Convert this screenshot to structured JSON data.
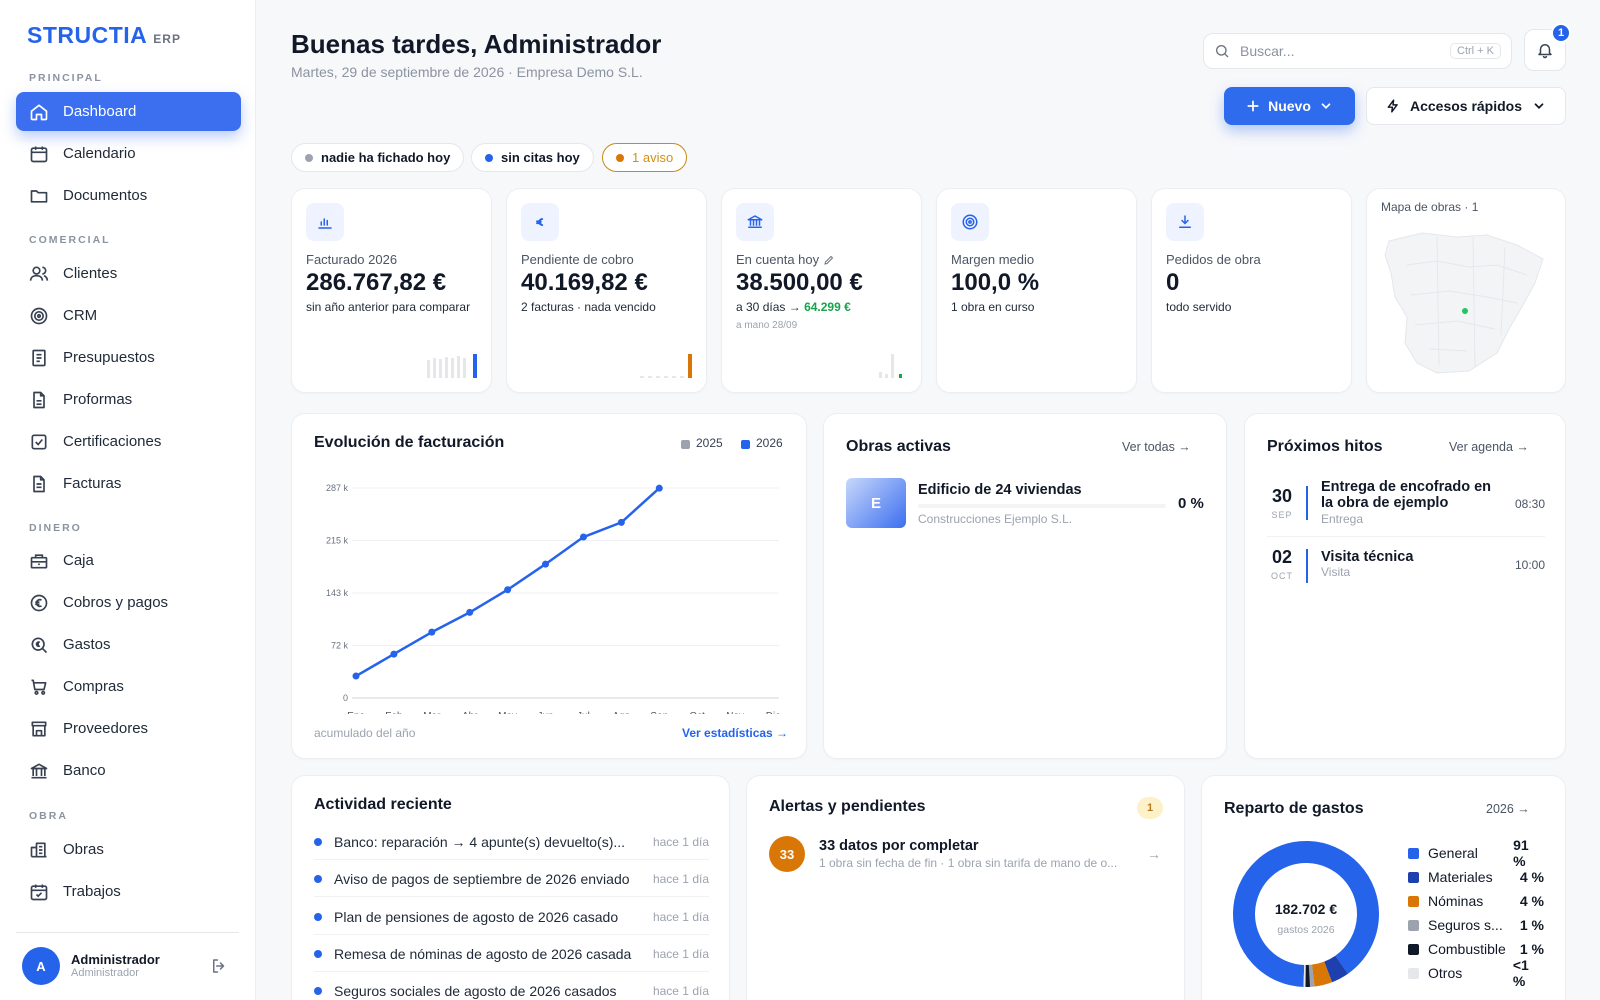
{
  "brand": {
    "name": "STRUCTIA",
    "suffix": "ERP"
  },
  "nav": {
    "sections": [
      "PRINCIPAL",
      "COMERCIAL",
      "DINERO",
      "OBRA"
    ],
    "items": [
      {
        "label": "Dashboard",
        "icon": "home-icon"
      },
      {
        "label": "Calendario",
        "icon": "calendar-icon"
      },
      {
        "label": "Documentos",
        "icon": "folder-icon"
      },
      {
        "label": "Clientes",
        "icon": "users-icon"
      },
      {
        "label": "CRM",
        "icon": "target-icon"
      },
      {
        "label": "Presupuestos",
        "icon": "document-list-icon"
      },
      {
        "label": "Proformas",
        "icon": "document-icon"
      },
      {
        "label": "Certificaciones",
        "icon": "checkbox-icon"
      },
      {
        "label": "Facturas",
        "icon": "invoice-icon"
      },
      {
        "label": "Caja",
        "icon": "cash-register-icon"
      },
      {
        "label": "Cobros y pagos",
        "icon": "euro-circle-icon"
      },
      {
        "label": "Gastos",
        "icon": "search-euro-icon"
      },
      {
        "label": "Compras",
        "icon": "cart-icon"
      },
      {
        "label": "Proveedores",
        "icon": "store-icon"
      },
      {
        "label": "Banco",
        "icon": "bank-icon"
      },
      {
        "label": "Obras",
        "icon": "buildings-icon"
      },
      {
        "label": "Trabajos",
        "icon": "calendar-check-icon"
      }
    ]
  },
  "user": {
    "initial": "A",
    "name": "Administrador",
    "role": "Administrador"
  },
  "header": {
    "greeting": "Buenas tardes, Administrador",
    "subtitle": "Martes, 29 de septiembre de 2026 · Empresa Demo S.L.",
    "search_placeholder": "Buscar...",
    "search_shortcut": "Ctrl + K",
    "notifications": "1",
    "new_button": "Nuevo",
    "quick_button": "Accesos rápidos"
  },
  "pills": [
    {
      "label": "nadie ha fichado hoy",
      "color": "#9ca3af"
    },
    {
      "label": "sin citas hoy",
      "color": "#2563eb"
    },
    {
      "label": "1 aviso",
      "color": "#d97706"
    }
  ],
  "kpis": [
    {
      "label": "Facturado 2026",
      "value": "286.767,82 €",
      "sub": "sin año anterior para comparar"
    },
    {
      "label": "Pendiente de cobro",
      "value": "40.169,82 €",
      "sub": "2 facturas · nada vencido"
    },
    {
      "label": "En cuenta hoy",
      "value": "38.500,00 €",
      "sub_prefix": "a 30 días →",
      "sub_value": "64.299 €",
      "sub2": "a mano 28/09"
    },
    {
      "label": "Margen medio",
      "value": "100,0 %",
      "sub": "1 obra en curso"
    },
    {
      "label": "Pedidos de obra",
      "value": "0",
      "sub": "todo servido"
    }
  ],
  "map": {
    "title": "Mapa de obras · 1"
  },
  "billing": {
    "title": "Evolución de facturación",
    "footer": "acumulado del año",
    "link": "Ver estadísticas →"
  },
  "chart_data": {
    "type": "line",
    "categories": [
      "Ene",
      "Feb",
      "Mar",
      "Abr",
      "May",
      "Jun",
      "Jul",
      "Ago",
      "Sep",
      "Oct",
      "Nov",
      "Dic"
    ],
    "series": [
      {
        "name": "2025",
        "color": "#9ca3af",
        "values": []
      },
      {
        "name": "2026",
        "color": "#2563eb",
        "values": [
          30000,
          60000,
          90000,
          117000,
          148000,
          183000,
          220000,
          240000,
          286767
        ]
      }
    ],
    "yticks": [
      "0",
      "72 k",
      "143 k",
      "215 k",
      "287 k"
    ],
    "ylim": [
      0,
      287000
    ],
    "grid": true,
    "legend": "top-right"
  },
  "obras": {
    "title": "Obras activas",
    "link": "Ver todas →",
    "items": [
      {
        "initial": "E",
        "name": "Edificio de 24 viviendas",
        "client": "Construcciones Ejemplo S.L.",
        "progress": "0 %"
      }
    ]
  },
  "hitos": {
    "title": "Próximos hitos",
    "link": "Ver agenda →",
    "items": [
      {
        "day": "30",
        "month": "SEP",
        "title": "Entrega de encofrado en la obra de ejemplo",
        "type": "Entrega",
        "time": "08:30"
      },
      {
        "day": "02",
        "month": "OCT",
        "title": "Visita técnica",
        "type": "Visita",
        "time": "10:00"
      }
    ]
  },
  "activity": {
    "title": "Actividad reciente",
    "items": [
      {
        "text": "Banco: reparación → 4 apunte(s) devuelto(s)...",
        "time": "hace 1 día"
      },
      {
        "text": "Aviso de pagos de septiembre de 2026 enviado",
        "time": "hace 1 día"
      },
      {
        "text": "Plan de pensiones de agosto de 2026 casado",
        "time": "hace 1 día"
      },
      {
        "text": "Remesa de nóminas de agosto de 2026 casada",
        "time": "hace 1 día"
      },
      {
        "text": "Seguros sociales de agosto de 2026 casados",
        "time": "hace 1 día"
      }
    ]
  },
  "alerts": {
    "title": "Alertas y pendientes",
    "count": "1",
    "items": [
      {
        "count": "33",
        "title": "33 datos por completar",
        "detail": "1 obra sin fecha de fin · 1 obra sin tarifa de mano de o..."
      }
    ]
  },
  "expenses": {
    "title": "Reparto de gastos",
    "link": "2026 →",
    "total": "182.702 €",
    "total_label": "gastos 2026",
    "items": [
      {
        "name": "General",
        "pct": "91 %",
        "value": 91,
        "color": "#2563eb"
      },
      {
        "name": "Materiales",
        "pct": "4 %",
        "value": 4,
        "color": "#1e40af"
      },
      {
        "name": "Nóminas",
        "pct": "4 %",
        "value": 4,
        "color": "#d97706"
      },
      {
        "name": "Seguros s...",
        "pct": "1 %",
        "value": 1,
        "color": "#9ca3af"
      },
      {
        "name": "Combustible",
        "pct": "1 %",
        "value": 1,
        "color": "#111827"
      },
      {
        "name": "Otros",
        "pct": "<1 %",
        "value": 0.5,
        "color": "#e5e7eb"
      }
    ]
  }
}
